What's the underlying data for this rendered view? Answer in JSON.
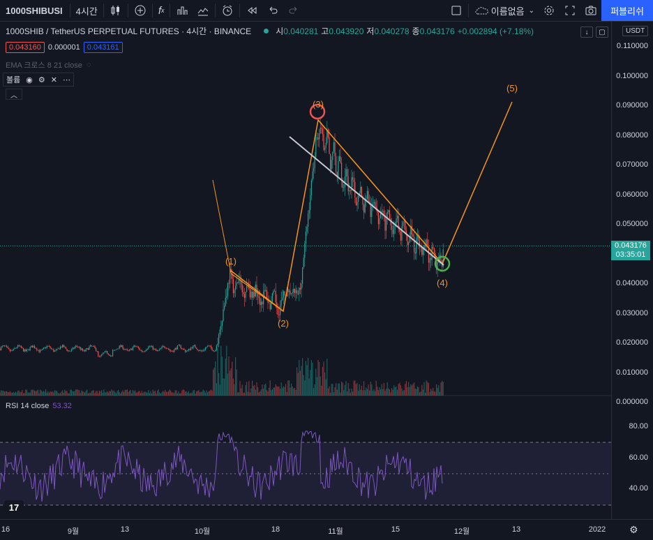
{
  "toolbar": {
    "symbol": "1000SHIBUSI",
    "interval": "4시간",
    "layout_name": "이름없음",
    "publish": "퍼블리쉬"
  },
  "legend": {
    "title": "1000SHIB / TetherUS PERPETUAL FUTURES · 4시간 · BINANCE",
    "open_label": "시",
    "open": "0.040281",
    "high_label": "고",
    "high": "0.043920",
    "low_label": "저",
    "low": "0.040278",
    "close_label": "종",
    "close": "0.043176",
    "change": "+0.002894 (+7.18%)"
  },
  "prices": {
    "sell": "0.043160",
    "spread": "0.000001",
    "buy": "0.043161"
  },
  "ema_label": "EMA 크로스 8 21 close",
  "volume_label": "볼륨",
  "currency": "USDT",
  "price_axis": [
    "0.110000",
    "0.100000",
    "0.090000",
    "0.080000",
    "0.070000",
    "0.060000",
    "0.050000",
    "0.040000",
    "0.030000",
    "0.020000",
    "0.010000",
    "0.000000"
  ],
  "current_price": {
    "value": "0.043176",
    "countdown": "03:35:01"
  },
  "rsi": {
    "label": "RSI 14 close",
    "value": "53.32",
    "axis": [
      "80.00",
      "60.00",
      "40.00"
    ]
  },
  "time_axis": [
    "16",
    "9월",
    "13",
    "10월",
    "18",
    "11월",
    "15",
    "12월",
    "13",
    "2022"
  ],
  "waves": [
    "(1)",
    "(2)",
    "(3)",
    "(4)",
    "(5)"
  ],
  "colors": {
    "bg": "#131722",
    "up": "#26a69a",
    "down": "#ef5350",
    "wave": "#f7931a",
    "rsi": "#7e57c2",
    "trendline": "#c8c8d0"
  }
}
